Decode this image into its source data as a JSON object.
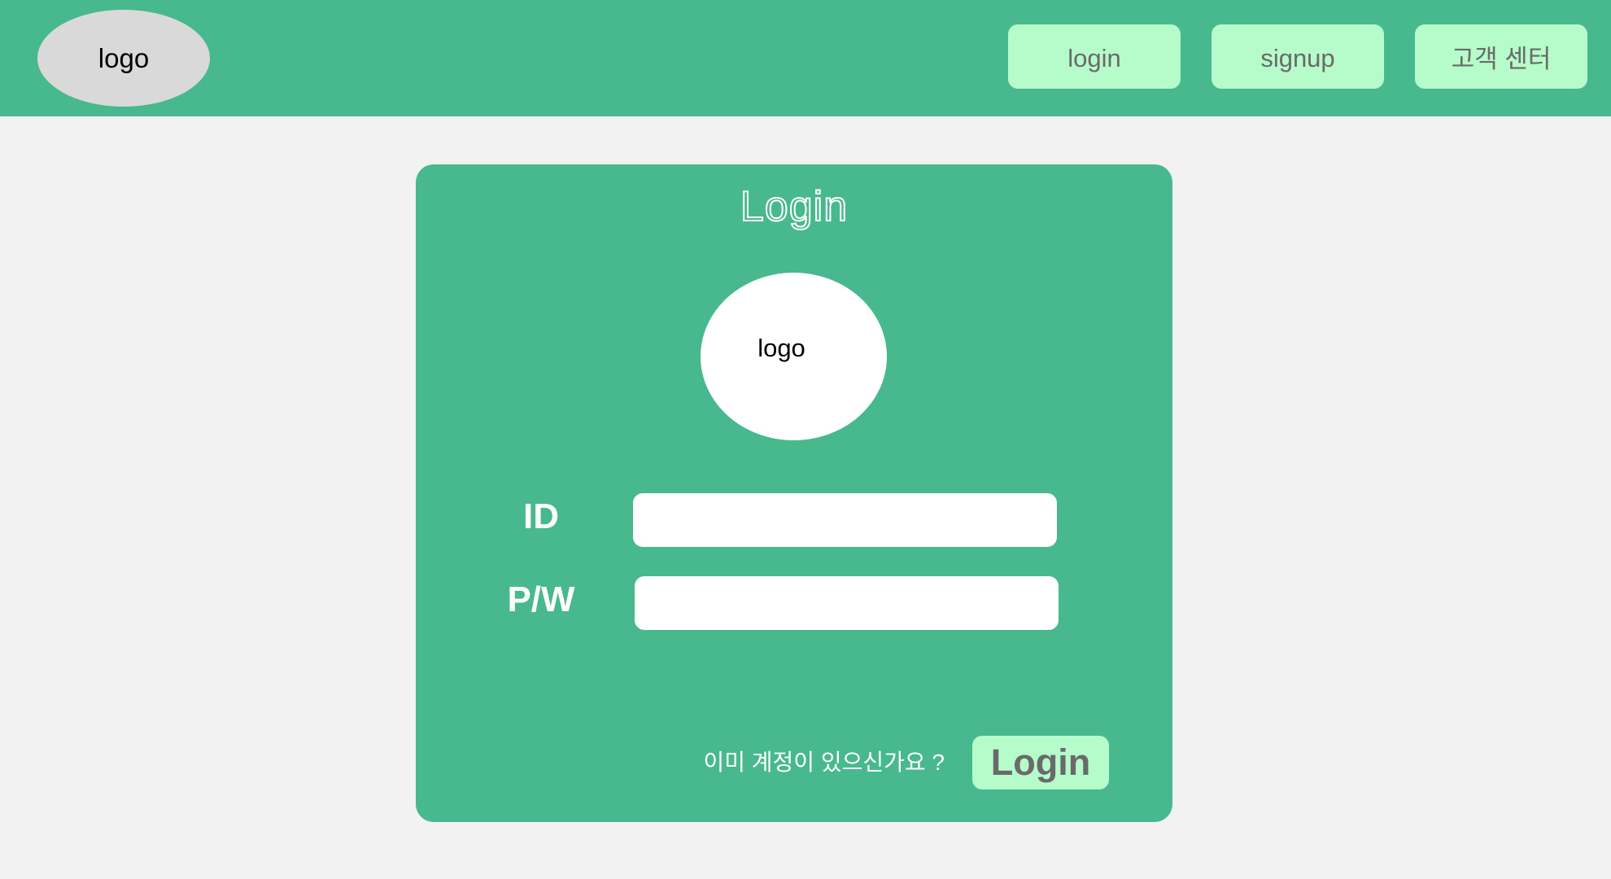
{
  "header": {
    "logo_text": "logo",
    "nav": {
      "login_label": "login",
      "signup_label": "signup",
      "support_label": "고객 센터"
    }
  },
  "login_card": {
    "title": "Login",
    "logo_text": "logo",
    "id_label": "ID",
    "id_value": "",
    "pw_label": "P/W",
    "pw_value": "",
    "prompt_text": "이미 계정이 있으신가요 ?",
    "submit_label": "Login"
  },
  "colors": {
    "primary_green": "#48b88f",
    "button_mint": "#b6fbca",
    "logo_gray": "#d9d9d9",
    "page_background": "#f2f2f2"
  }
}
